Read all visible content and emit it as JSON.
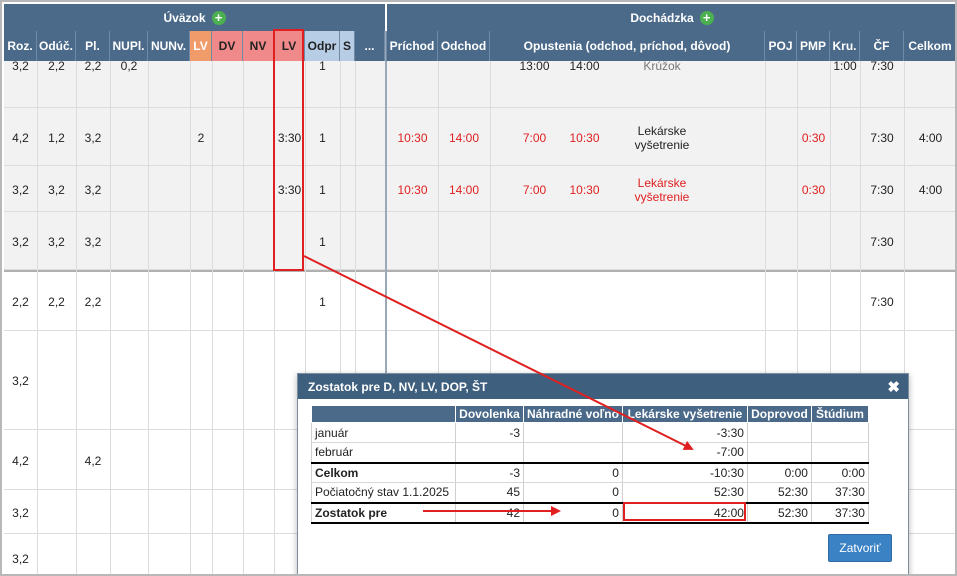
{
  "groups": {
    "uvazok": "Úväzok",
    "dochadzka": "Dochádzka"
  },
  "headers": [
    "Roz.",
    "Odúč.",
    "Pl.",
    "NUPl.",
    "NUNv.",
    "LV",
    "DV",
    "NV",
    "LV",
    "Odpr",
    "S",
    "...",
    "Príchod",
    "Odchod",
    "Opustenia (odchod, príchod, dôvod)",
    "POJ",
    "PMP",
    "Kru.",
    "ČF",
    "Celkom"
  ],
  "rows": [
    {
      "roz": "3,2",
      "oduc": "2,2",
      "pl": "2,2",
      "nupl": "0,2",
      "lv1": "",
      "lv2": "",
      "odpr": "1",
      "prichod": "",
      "odchod": "",
      "op_odchod": "13:00",
      "op_prichod": "14:00",
      "op_dovod": "Krúžok",
      "pmp": "",
      "kru": "1:00",
      "cf": "7:30",
      "celkom": ""
    },
    {
      "roz": "4,2",
      "oduc": "1,2",
      "pl": "3,2",
      "nupl": "",
      "lv1": "2",
      "lv2": "3:30",
      "odpr": "1",
      "prichod": "10:30",
      "odchod": "14:00",
      "op_odchod": "7:00",
      "op_prichod": "10:30",
      "op_dovod": "Lekárske vyšetrenie",
      "pmp": "0:30",
      "kru": "",
      "cf": "7:30",
      "celkom": "4:00"
    },
    {
      "roz": "3,2",
      "oduc": "3,2",
      "pl": "3,2",
      "nupl": "",
      "lv1": "",
      "lv2": "3:30",
      "odpr": "1",
      "prichod": "10:30",
      "odchod": "14:00",
      "op_odchod": "7:00",
      "op_prichod": "10:30",
      "op_dovod": "Lekárske vyšetrenie",
      "pmp": "0:30",
      "kru": "",
      "cf": "7:30",
      "celkom": "4:00"
    },
    {
      "roz": "3,2",
      "oduc": "3,2",
      "pl": "3,2",
      "nupl": "",
      "lv1": "",
      "lv2": "",
      "odpr": "1",
      "prichod": "",
      "odchod": "",
      "op_odchod": "",
      "op_prichod": "",
      "op_dovod": "",
      "pmp": "",
      "kru": "",
      "cf": "7:30",
      "celkom": ""
    },
    {
      "roz": "2,2",
      "oduc": "2,2",
      "pl": "2,2",
      "nupl": "",
      "lv1": "",
      "lv2": "",
      "odpr": "1",
      "prichod": "",
      "odchod": "",
      "op_odchod": "",
      "op_prichod": "",
      "op_dovod": "",
      "pmp": "",
      "kru": "",
      "cf": "7:30",
      "celkom": ""
    },
    {
      "roz": "3,2",
      "oduc": "",
      "pl": "",
      "nupl": "",
      "lv1": "",
      "lv2": "",
      "odpr": "",
      "prichod": "",
      "odchod": "",
      "op_odchod": "",
      "op_prichod": "",
      "op_dovod": "",
      "pmp": "",
      "kru": "",
      "cf": "",
      "celkom": ""
    },
    {
      "roz": "4,2",
      "oduc": "",
      "pl": "4,2",
      "nupl": "",
      "lv1": "",
      "lv2": "",
      "odpr": "",
      "prichod": "",
      "odchod": "",
      "op_odchod": "",
      "op_prichod": "",
      "op_dovod": "",
      "pmp": "",
      "kru": "",
      "cf": "",
      "celkom": ""
    },
    {
      "roz": "3,2",
      "oduc": "",
      "pl": "",
      "nupl": "",
      "lv1": "",
      "lv2": "",
      "odpr": "",
      "prichod": "",
      "odchod": "",
      "op_odchod": "",
      "op_prichod": "",
      "op_dovod": "",
      "pmp": "",
      "kru": "",
      "cf": "",
      "celkom": ""
    },
    {
      "roz": "3,2",
      "oduc": "",
      "pl": "",
      "nupl": "",
      "lv1": "",
      "lv2": "",
      "odpr": "",
      "prichod": "",
      "odchod": "",
      "op_odchod": "",
      "op_prichod": "",
      "op_dovod": "",
      "pmp": "",
      "kru": "",
      "cf": "",
      "celkom": ""
    }
  ],
  "modal": {
    "title": "Zostatok pre D, NV, LV, DOP, ŠT",
    "columns": [
      "",
      "Dovolenka",
      "Náhradné voľno",
      "Lekárske vyšetrenie",
      "Doprovod",
      "Štúdium"
    ],
    "rows": [
      [
        "január",
        "-3",
        "",
        "-3:30",
        "",
        ""
      ],
      [
        "február",
        "",
        "",
        "-7:00",
        "",
        ""
      ],
      [
        "Celkom",
        "-3",
        "0",
        "-10:30",
        "0:00",
        "0:00"
      ],
      [
        "Počiatočný stav 1.1.2025",
        "45",
        "0",
        "52:30",
        "52:30",
        "37:30"
      ],
      [
        "Zostatok pre",
        "42",
        "0",
        "42:00",
        "52:30",
        "37:30"
      ]
    ],
    "button": "Zatvoriť"
  },
  "colors": {
    "header_blue": "#4b6a8a",
    "highlight_red": "#e02020",
    "button_blue": "#3b82c4"
  }
}
